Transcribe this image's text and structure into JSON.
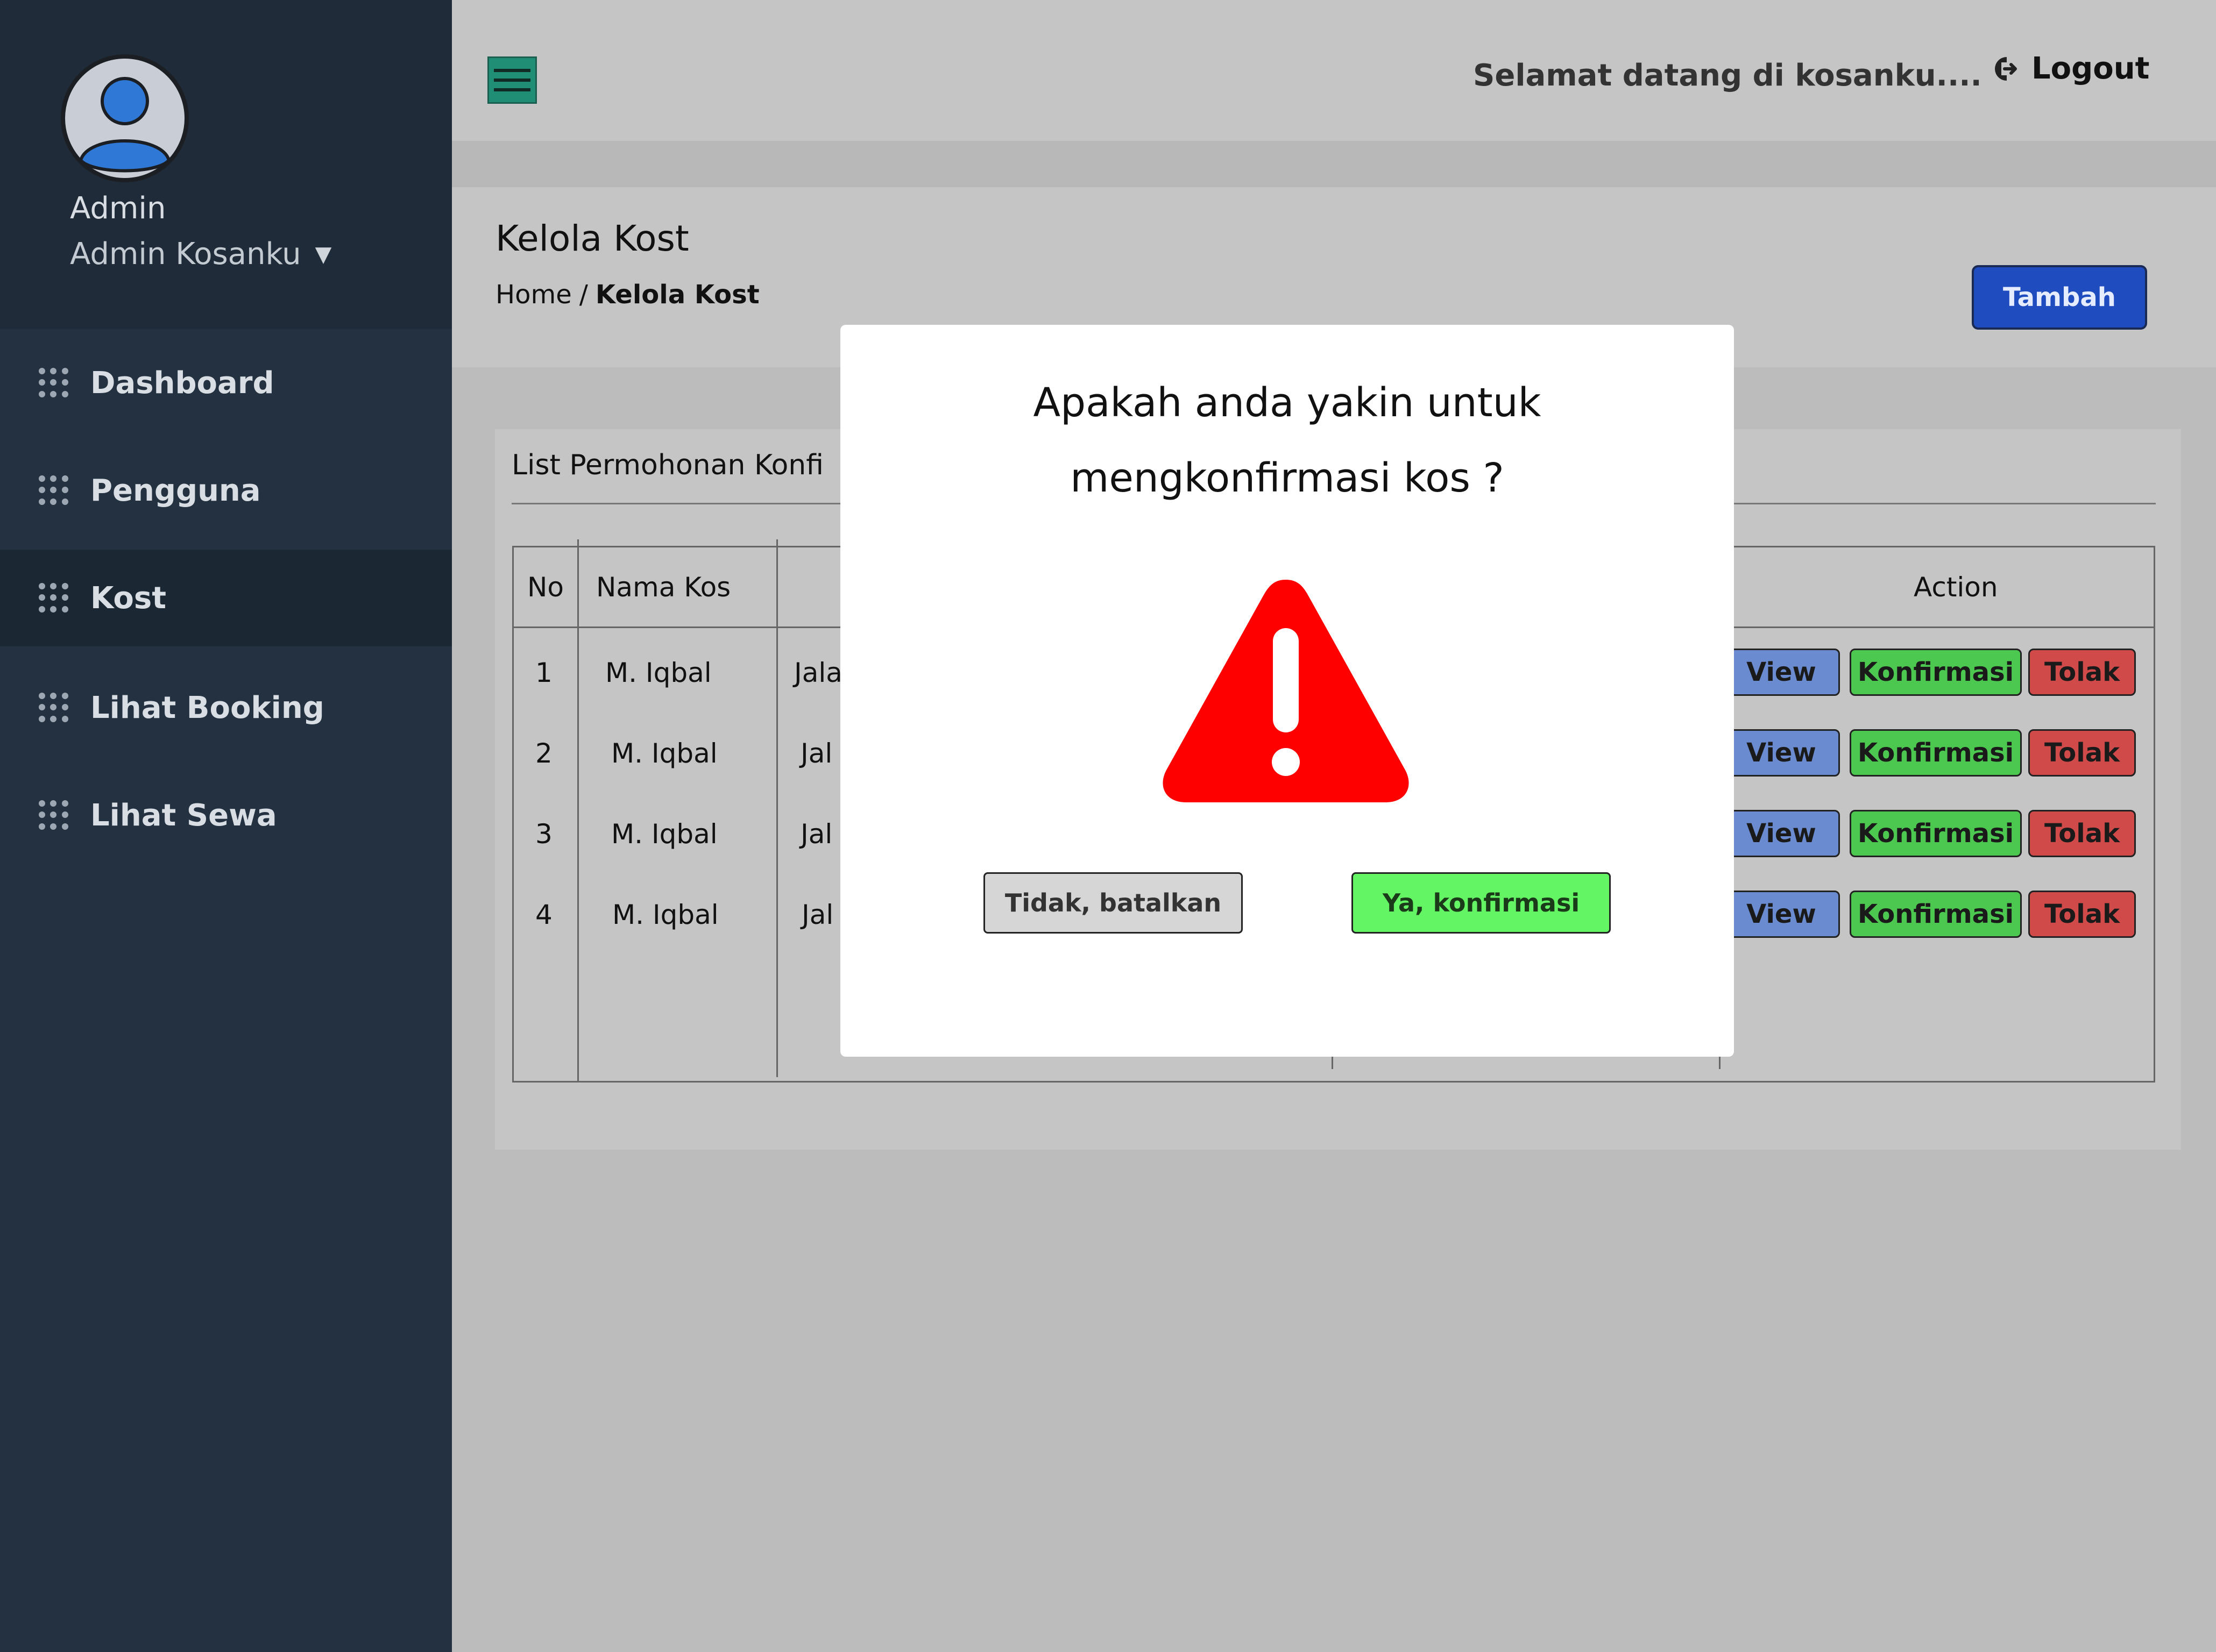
{
  "sidebar": {
    "admin_name": "Admin",
    "admin_role": "Admin Kosanku",
    "items": [
      {
        "label": "Dashboard"
      },
      {
        "label": "Pengguna"
      },
      {
        "label": "Kost"
      },
      {
        "label": "Lihat Booking"
      },
      {
        "label": "Lihat Sewa"
      }
    ]
  },
  "header": {
    "welcome": "Selamat datang di kosanku....",
    "logout_label": "Logout"
  },
  "page": {
    "title": "Kelola Kost",
    "breadcrumb_home": "Home",
    "breadcrumb_sep": "/",
    "breadcrumb_current": "Kelola Kost",
    "add_label": "Tambah"
  },
  "card": {
    "title": "List Permohonan Konfi",
    "table": {
      "headers": {
        "no": "No",
        "name": "Nama Kos",
        "action": "Action"
      },
      "rows": [
        {
          "no": "1",
          "name": "M. Iqbal",
          "address": "Jalа"
        },
        {
          "no": "2",
          "name": "M. Iqbal",
          "address": "Jal"
        },
        {
          "no": "3",
          "name": "M. Iqbal",
          "address": "Jal"
        },
        {
          "no": "4",
          "name": "M. Iqbal",
          "address": "Jal"
        }
      ],
      "view_label": "View",
      "confirm_label": "Konfirmasi",
      "reject_label": "Tolak"
    }
  },
  "modal": {
    "line1": "Apakah anda yakin untuk",
    "line2": "mengkonfirmasi kos ?",
    "icon": "warning-icon",
    "cancel_label": "Tidak, batalkan",
    "confirm_label": "Ya, konfirmasi"
  },
  "colors": {
    "sidebar": "#243140",
    "accent_green": "#1f8e75",
    "primary_blue": "#1f4dbf",
    "warning_red": "#ff0000",
    "confirm_green": "#63f563"
  }
}
